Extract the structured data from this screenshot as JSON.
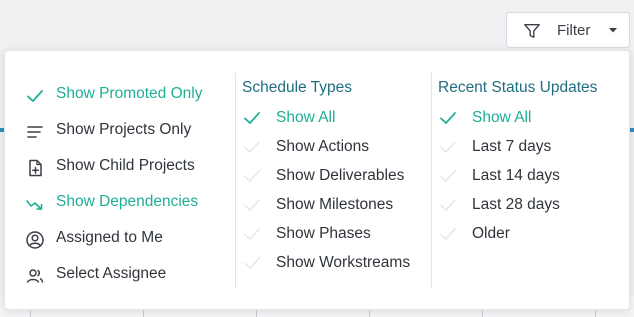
{
  "filter_button": {
    "label": "Filter",
    "icon": "funnel-icon"
  },
  "colors": {
    "accent": "#1fae94",
    "heading": "#1f6e82",
    "text": "#2f343b",
    "faint_check": "#e8ebee"
  },
  "view_options": [
    {
      "label": "Show Promoted Only",
      "icon": "check-icon",
      "active": true
    },
    {
      "label": "Show Projects Only",
      "icon": "list-lines-icon",
      "active": false
    },
    {
      "label": "Show Child Projects",
      "icon": "document-add-icon",
      "active": false
    },
    {
      "label": "Show Dependencies",
      "icon": "dependency-arrow-icon",
      "active": true
    },
    {
      "label": "Assigned to Me",
      "icon": "user-circle-icon",
      "active": false
    },
    {
      "label": "Select Assignee",
      "icon": "users-icon",
      "active": false
    }
  ],
  "schedule_types": {
    "heading": "Schedule Types",
    "items": [
      {
        "label": "Show All",
        "checked": true
      },
      {
        "label": "Show Actions",
        "checked": false
      },
      {
        "label": "Show Deliverables",
        "checked": false
      },
      {
        "label": "Show Milestones",
        "checked": false
      },
      {
        "label": "Show Phases",
        "checked": false
      },
      {
        "label": "Show Workstreams",
        "checked": false
      }
    ]
  },
  "recent_status_updates": {
    "heading": "Recent Status Updates",
    "items": [
      {
        "label": "Show All",
        "checked": true
      },
      {
        "label": "Last 7 days",
        "checked": false
      },
      {
        "label": "Last 14 days",
        "checked": false
      },
      {
        "label": "Last 28 days",
        "checked": false
      },
      {
        "label": "Older",
        "checked": false
      }
    ]
  }
}
